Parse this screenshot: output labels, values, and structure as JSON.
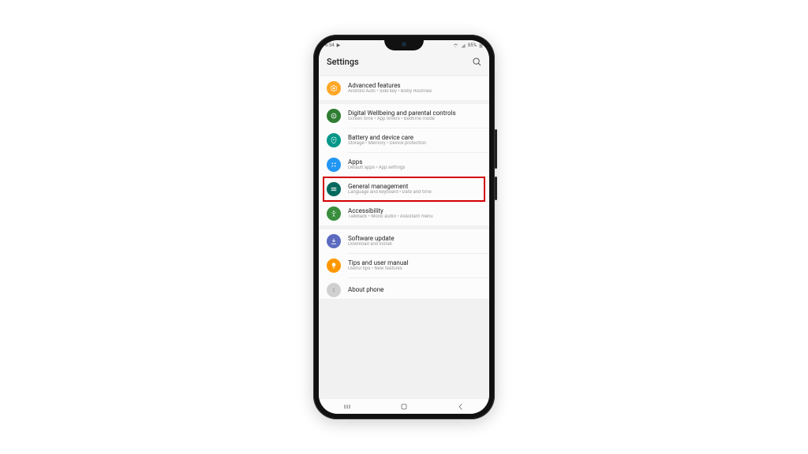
{
  "status": {
    "time": "6:54",
    "battery": "85%"
  },
  "header": {
    "title": "Settings"
  },
  "items": [
    {
      "title": "Advanced features",
      "sub": "Android Auto • Side key • Bixby Routines"
    },
    {
      "title": "Digital Wellbeing and parental controls",
      "sub": "Screen time • App timers • Bedtime mode"
    },
    {
      "title": "Battery and device care",
      "sub": "Storage • Memory • Device protection"
    },
    {
      "title": "Apps",
      "sub": "Default apps • App settings"
    },
    {
      "title": "General management",
      "sub": "Language and keyboard • Date and time"
    },
    {
      "title": "Accessibility",
      "sub": "TalkBack • Mono audio • Assistant menu"
    },
    {
      "title": "Software update",
      "sub": "Download and install"
    },
    {
      "title": "Tips and user manual",
      "sub": "Useful tips • New features"
    },
    {
      "title": "About phone",
      "sub": ""
    }
  ]
}
